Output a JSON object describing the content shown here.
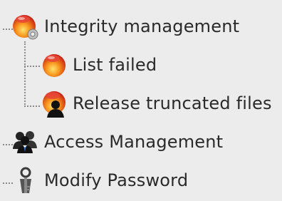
{
  "tree": {
    "items": [
      {
        "label": "Integrity management",
        "icon": "integrity-orb-icon"
      },
      {
        "label": "List failed",
        "icon": "flame-orb-icon"
      },
      {
        "label": "Release truncated files",
        "icon": "user-flame-orb-icon"
      },
      {
        "label": "Access Management",
        "icon": "users-group-icon"
      },
      {
        "label": "Modify Password",
        "icon": "key-person-icon"
      }
    ]
  },
  "colors": {
    "background": "#ececec",
    "text": "#2a2a2a",
    "orb_red": "#d8261b",
    "orb_orange": "#f7941d",
    "orb_yellow": "#ffe36b"
  }
}
